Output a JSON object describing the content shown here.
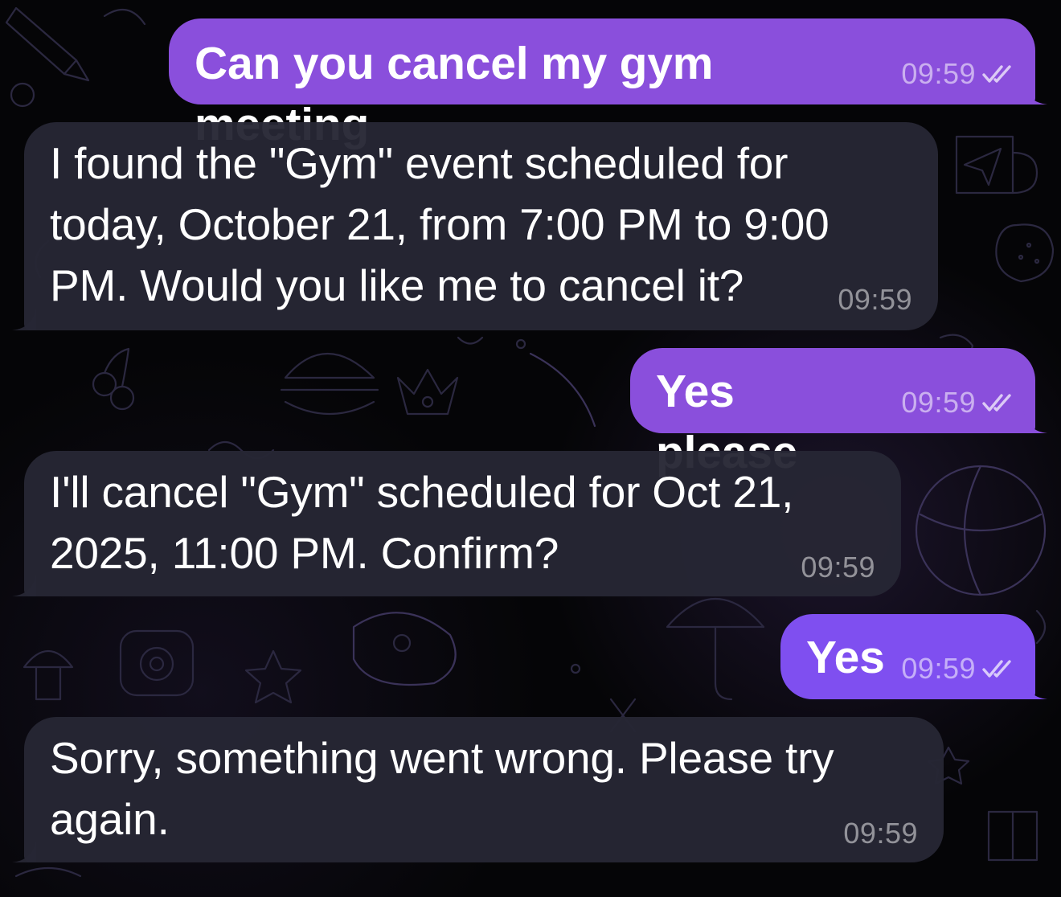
{
  "messages": [
    {
      "direction": "outgoing",
      "text": "Can you cancel my gym meeting",
      "time": "09:59",
      "status_icon": "double-check-icon"
    },
    {
      "direction": "incoming",
      "text": "I found the \"Gym\" event scheduled for today, October 21, from 7:00 PM to 9:00 PM. Would you like me to cancel it?",
      "time": "09:59"
    },
    {
      "direction": "outgoing",
      "text": "Yes please",
      "time": "09:59",
      "status_icon": "double-check-icon"
    },
    {
      "direction": "incoming",
      "text": "I'll cancel \"Gym\" scheduled for Oct 21, 2025, 11:00 PM. Confirm?",
      "time": "09:59"
    },
    {
      "direction": "outgoing",
      "text": "Yes",
      "time": "09:59",
      "status_icon": "double-check-icon"
    },
    {
      "direction": "incoming",
      "text": "Sorry, something went wrong. Please try again.",
      "time": "09:59"
    }
  ],
  "colors": {
    "outgoing_bubble": "#8a4fdc",
    "incoming_bubble": "#26263a",
    "background": "#050507"
  }
}
